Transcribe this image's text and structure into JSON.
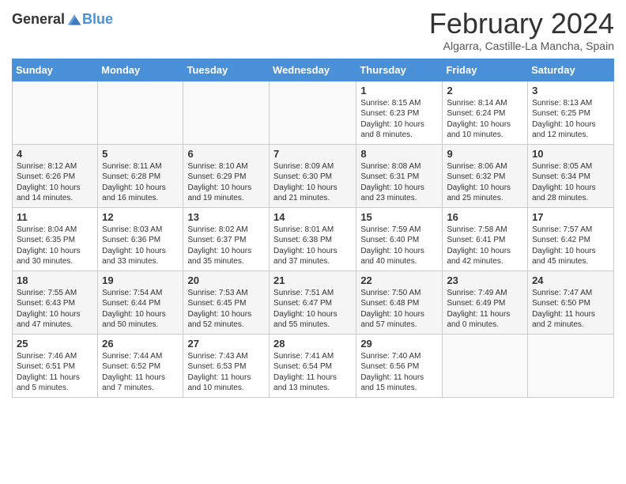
{
  "logo": {
    "general": "General",
    "blue": "Blue"
  },
  "title": "February 2024",
  "location": "Algarra, Castille-La Mancha, Spain",
  "headers": [
    "Sunday",
    "Monday",
    "Tuesday",
    "Wednesday",
    "Thursday",
    "Friday",
    "Saturday"
  ],
  "weeks": [
    [
      {
        "day": "",
        "info": ""
      },
      {
        "day": "",
        "info": ""
      },
      {
        "day": "",
        "info": ""
      },
      {
        "day": "",
        "info": ""
      },
      {
        "day": "1",
        "info": "Sunrise: 8:15 AM\nSunset: 6:23 PM\nDaylight: 10 hours and 8 minutes."
      },
      {
        "day": "2",
        "info": "Sunrise: 8:14 AM\nSunset: 6:24 PM\nDaylight: 10 hours and 10 minutes."
      },
      {
        "day": "3",
        "info": "Sunrise: 8:13 AM\nSunset: 6:25 PM\nDaylight: 10 hours and 12 minutes."
      }
    ],
    [
      {
        "day": "4",
        "info": "Sunrise: 8:12 AM\nSunset: 6:26 PM\nDaylight: 10 hours and 14 minutes."
      },
      {
        "day": "5",
        "info": "Sunrise: 8:11 AM\nSunset: 6:28 PM\nDaylight: 10 hours and 16 minutes."
      },
      {
        "day": "6",
        "info": "Sunrise: 8:10 AM\nSunset: 6:29 PM\nDaylight: 10 hours and 19 minutes."
      },
      {
        "day": "7",
        "info": "Sunrise: 8:09 AM\nSunset: 6:30 PM\nDaylight: 10 hours and 21 minutes."
      },
      {
        "day": "8",
        "info": "Sunrise: 8:08 AM\nSunset: 6:31 PM\nDaylight: 10 hours and 23 minutes."
      },
      {
        "day": "9",
        "info": "Sunrise: 8:06 AM\nSunset: 6:32 PM\nDaylight: 10 hours and 25 minutes."
      },
      {
        "day": "10",
        "info": "Sunrise: 8:05 AM\nSunset: 6:34 PM\nDaylight: 10 hours and 28 minutes."
      }
    ],
    [
      {
        "day": "11",
        "info": "Sunrise: 8:04 AM\nSunset: 6:35 PM\nDaylight: 10 hours and 30 minutes."
      },
      {
        "day": "12",
        "info": "Sunrise: 8:03 AM\nSunset: 6:36 PM\nDaylight: 10 hours and 33 minutes."
      },
      {
        "day": "13",
        "info": "Sunrise: 8:02 AM\nSunset: 6:37 PM\nDaylight: 10 hours and 35 minutes."
      },
      {
        "day": "14",
        "info": "Sunrise: 8:01 AM\nSunset: 6:38 PM\nDaylight: 10 hours and 37 minutes."
      },
      {
        "day": "15",
        "info": "Sunrise: 7:59 AM\nSunset: 6:40 PM\nDaylight: 10 hours and 40 minutes."
      },
      {
        "day": "16",
        "info": "Sunrise: 7:58 AM\nSunset: 6:41 PM\nDaylight: 10 hours and 42 minutes."
      },
      {
        "day": "17",
        "info": "Sunrise: 7:57 AM\nSunset: 6:42 PM\nDaylight: 10 hours and 45 minutes."
      }
    ],
    [
      {
        "day": "18",
        "info": "Sunrise: 7:55 AM\nSunset: 6:43 PM\nDaylight: 10 hours and 47 minutes."
      },
      {
        "day": "19",
        "info": "Sunrise: 7:54 AM\nSunset: 6:44 PM\nDaylight: 10 hours and 50 minutes."
      },
      {
        "day": "20",
        "info": "Sunrise: 7:53 AM\nSunset: 6:45 PM\nDaylight: 10 hours and 52 minutes."
      },
      {
        "day": "21",
        "info": "Sunrise: 7:51 AM\nSunset: 6:47 PM\nDaylight: 10 hours and 55 minutes."
      },
      {
        "day": "22",
        "info": "Sunrise: 7:50 AM\nSunset: 6:48 PM\nDaylight: 10 hours and 57 minutes."
      },
      {
        "day": "23",
        "info": "Sunrise: 7:49 AM\nSunset: 6:49 PM\nDaylight: 11 hours and 0 minutes."
      },
      {
        "day": "24",
        "info": "Sunrise: 7:47 AM\nSunset: 6:50 PM\nDaylight: 11 hours and 2 minutes."
      }
    ],
    [
      {
        "day": "25",
        "info": "Sunrise: 7:46 AM\nSunset: 6:51 PM\nDaylight: 11 hours and 5 minutes."
      },
      {
        "day": "26",
        "info": "Sunrise: 7:44 AM\nSunset: 6:52 PM\nDaylight: 11 hours and 7 minutes."
      },
      {
        "day": "27",
        "info": "Sunrise: 7:43 AM\nSunset: 6:53 PM\nDaylight: 11 hours and 10 minutes."
      },
      {
        "day": "28",
        "info": "Sunrise: 7:41 AM\nSunset: 6:54 PM\nDaylight: 11 hours and 13 minutes."
      },
      {
        "day": "29",
        "info": "Sunrise: 7:40 AM\nSunset: 6:56 PM\nDaylight: 11 hours and 15 minutes."
      },
      {
        "day": "",
        "info": ""
      },
      {
        "day": "",
        "info": ""
      }
    ]
  ]
}
